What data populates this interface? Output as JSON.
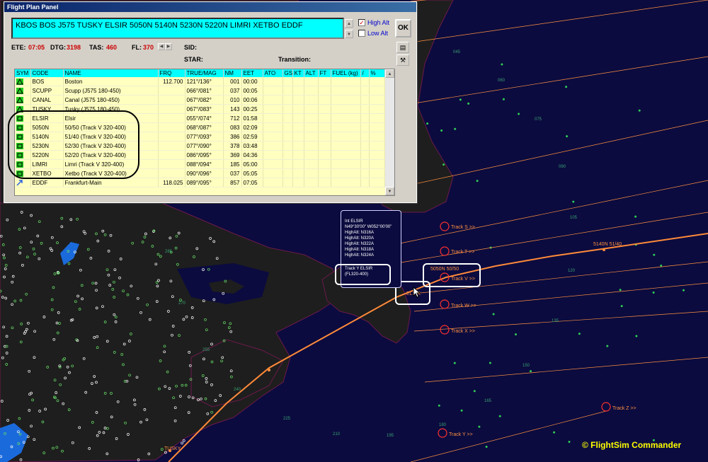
{
  "window": {
    "title": "Flight Plan Panel"
  },
  "route": {
    "text": "KBOS BOS J575 TUSKY ELSIR 5050N 5140N 5230N 5220N LIMRI XETBO EDDF"
  },
  "options": {
    "high_alt": "High Alt",
    "low_alt": "Low Alt",
    "high_alt_checked": true,
    "low_alt_checked": false,
    "ok_label": "OK"
  },
  "info": {
    "ete_label": "ETE:",
    "ete": "07:05",
    "dtg_label": "DTG:",
    "dtg": "3198",
    "tas_label": "TAS:",
    "tas": "460",
    "fl_label": "FL:",
    "fl": "370",
    "sid_label": "SID:",
    "star_label": "STAR:",
    "transition_label": "Transition:"
  },
  "table": {
    "columns": [
      "SYM",
      "CODE",
      "NAME",
      "FRQ",
      "TRUE/MAG",
      "NM",
      "EET",
      "ATO",
      "GS",
      "KT",
      "ALT",
      "FT",
      "FUEL (kg)",
      "/",
      "%"
    ],
    "rows": [
      {
        "sym": "vor",
        "code": "BOS",
        "name": "Boston",
        "frq": "112.700",
        "truemag": "121°/136°",
        "nm": "001",
        "eet": "00:00"
      },
      {
        "sym": "triangle",
        "code": "SCUPP",
        "name": "Scupp (J575 180-450)",
        "frq": "",
        "truemag": "066°/081°",
        "nm": "037",
        "eet": "00:05"
      },
      {
        "sym": "triangle",
        "code": "CANAL",
        "name": "Canal (J575 180-450)",
        "frq": "",
        "truemag": "067°/082°",
        "nm": "010",
        "eet": "00:06"
      },
      {
        "sym": "triangle",
        "code": "TUSKY",
        "name": "Tusky (J575 180-450)",
        "frq": "",
        "truemag": "067°/083°",
        "nm": "143",
        "eet": "00:25"
      },
      {
        "sym": "square",
        "code": "ELSIR",
        "name": "Elsir",
        "frq": "",
        "truemag": "055°/074°",
        "nm": "712",
        "eet": "01:58"
      },
      {
        "sym": "square",
        "code": "5050N",
        "name": "50/50 (Track V 320-400)",
        "frq": "",
        "truemag": "068°/087°",
        "nm": "083",
        "eet": "02:09"
      },
      {
        "sym": "square",
        "code": "5140N",
        "name": "51/40 (Track V 320-400)",
        "frq": "",
        "truemag": "077°/093°",
        "nm": "386",
        "eet": "02:59"
      },
      {
        "sym": "square",
        "code": "5230N",
        "name": "52/30 (Track V 320-400)",
        "frq": "",
        "truemag": "077°/090°",
        "nm": "378",
        "eet": "03:48"
      },
      {
        "sym": "square",
        "code": "5220N",
        "name": "52/20 (Track V 320-400)",
        "frq": "",
        "truemag": "086°/095°",
        "nm": "369",
        "eet": "04:36"
      },
      {
        "sym": "square",
        "code": "LIMRI",
        "name": "Limri (Track V 320-400)",
        "frq": "",
        "truemag": "088°/094°",
        "nm": "185",
        "eet": "05:00"
      },
      {
        "sym": "square",
        "code": "XETBO",
        "name": "Xetbo (Track V 320-400)",
        "frq": "",
        "truemag": "090°/096°",
        "nm": "037",
        "eet": "05:05"
      },
      {
        "sym": "airport",
        "code": "EDDF",
        "name": "Frankfurt-Main",
        "frq": "118.025",
        "truemag": "089°/095°",
        "nm": "857",
        "eet": "07:05"
      }
    ]
  },
  "popup": {
    "lines": [
      "Int ELSIR",
      "N49°30'00\" W052°00'00\"",
      "HighAlt: N316A",
      "HighAlt: N320A",
      "HighAlt: N322A",
      "HighAlt: N318A",
      "HighAlt: N324A"
    ],
    "track_line1": "Track Y ELSIR",
    "track_line2": "(FL320-400)"
  },
  "map": {
    "tracks": [
      "Track S >>",
      "Track T >>",
      "Track V >>",
      "Track W >>",
      "Track X >>",
      "Track Y >>",
      "Track Z >>"
    ],
    "labels": {
      "p5050": "5050N 50/50",
      "p5140": "5140N 51/40",
      "elsir": "ELSIR",
      "tusky": "TUSKY"
    },
    "numbers": [
      "045",
      "060",
      "075",
      "090",
      "105",
      "120",
      "135",
      "150",
      "165",
      "180",
      "195",
      "210",
      "225",
      "240",
      "255",
      "270",
      "285"
    ]
  },
  "colors": {
    "track": "#ff9040",
    "route": "#ff9040",
    "land": "#1f1f1f",
    "water": "#0b0b3f",
    "accent": "#00ffff",
    "copyright": "#ffff00"
  },
  "copyright": "© FlightSim Commander"
}
